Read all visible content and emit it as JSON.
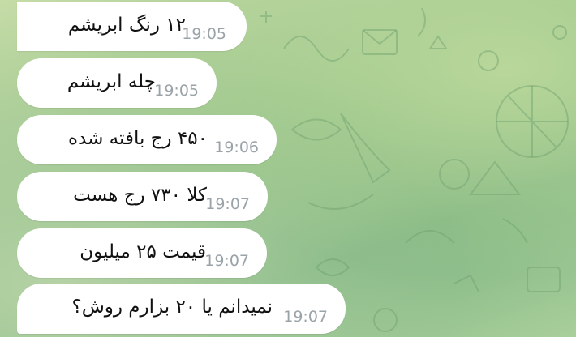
{
  "chat": {
    "messages": [
      {
        "text": "۱۲ رنگ ابریشم",
        "time": "19:05"
      },
      {
        "text": "چله ابریشم",
        "time": "19:05"
      },
      {
        "text": "۴۵۰ رج بافته شده",
        "time": "19:06"
      },
      {
        "text": "کلا ۷۳۰ رج هست",
        "time": "19:07"
      },
      {
        "text": "قیمت ۲۵ میلیون",
        "time": "19:07"
      },
      {
        "text": "نمیدانم یا ۲۰ بزارم روش؟",
        "time": "19:07"
      }
    ]
  },
  "colors": {
    "bubble": "#ffffff",
    "time_text": "#9aa3a8",
    "background_green": "#8fbf86"
  },
  "icons": [
    "chat-wallpaper-doodles"
  ]
}
